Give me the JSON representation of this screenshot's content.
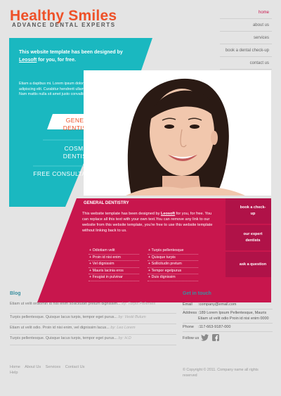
{
  "header": {
    "logo_title": "Healthy Smiles",
    "logo_subtitle": "ADVANCE DENTAL EXPERTS"
  },
  "nav": {
    "items": [
      {
        "label": "home",
        "active": true
      },
      {
        "label": "about us",
        "active": false
      },
      {
        "label": "services",
        "active": false
      },
      {
        "label": "book a dental check-up",
        "active": false
      },
      {
        "label": "contact us",
        "active": false
      }
    ]
  },
  "hero": {
    "heading_pre": "This website template has been designed by",
    "heading_link": "Leosoft",
    "heading_post": "for you, for free.",
    "body": "Etiam a dapibus mi. Lorem ipsum dolor sit amet, consectetur adipiscing elit. Curabitur hendrerit ullamcorper mauris a porttitor. Nam mattis nulla sit amet justo convallis fermentum (...)",
    "services": [
      {
        "label": "GENERAL DENTISTRY",
        "active": true
      },
      {
        "label": "COSMETIC DENTISTRY",
        "active": false
      },
      {
        "label": "FREE CONSULTATION",
        "active": false
      }
    ]
  },
  "feature": {
    "title": "GENERAL DENTISTRY",
    "body_pre": "This website template has been designed by",
    "body_link": "Leosoft",
    "body_post": "for you, for free. You can replace all this text with your own text.You can remove any link to our website from this website template, you're free to use this website template without linking back to us.",
    "list_left": [
      "+ Odiotiam velit",
      "+ Proin id nisi enim",
      "+ Vel dignissim",
      "+ Mauris lacinia eros",
      "+ Feugiat in pulvinar"
    ],
    "list_right": [
      "+ Turpis pellentesque",
      "+ Quisque turpis",
      "+ Sollicitudin pretum",
      "+ Tempor egetpurus",
      "+ Duis dignissim"
    ]
  },
  "side_buttons": [
    {
      "label": "book a check-up"
    },
    {
      "label": "our expert dentists"
    },
    {
      "label": "ask a question"
    }
  ],
  "blog": {
    "title": "Blog",
    "items": [
      {
        "text": "Etiam ut velit ordiomin id nisi enim sollicitudin pretum dignissim...",
        "by": "by: Turpis Pellentes"
      },
      {
        "text": "Turpis pellentesque. Quisque lacus turpis, tempor eget purus...",
        "by": "by: Vestii Bulum"
      },
      {
        "text": "Etiam ut velit odio. Proin id nisi enim, vel dignissim lacus...",
        "by": "by: Leo Lorem"
      },
      {
        "text": "Turpis pellentesque. Quisque lacus turpis, tempor eget purus...",
        "by": "by: H.D"
      }
    ]
  },
  "footer_nav": [
    "Home",
    "About Us",
    "Services",
    "Contact Us",
    "Help"
  ],
  "contact": {
    "title": "Get in touch",
    "email_label": "Email",
    "email_value": ":company@email.com",
    "address_label": "Address",
    "address_value": ":189 Lorem Ipsum Pellentesque, Mauris Etiam ut velit odio Proin id nisi enim 0000",
    "phone_label": "Phone",
    "phone_value": ":117-663-9187-000",
    "follow_label": "Follow us",
    "copyright": "© Copyright © 2011. Company name all rights reserved"
  },
  "colors": {
    "accent_orange": "#ee5128",
    "teal": "#1ab8c0",
    "magenta": "#c8164d",
    "dark_magenta": "#b01248"
  },
  "icons": [
    "twitter-icon",
    "facebook-icon"
  ]
}
